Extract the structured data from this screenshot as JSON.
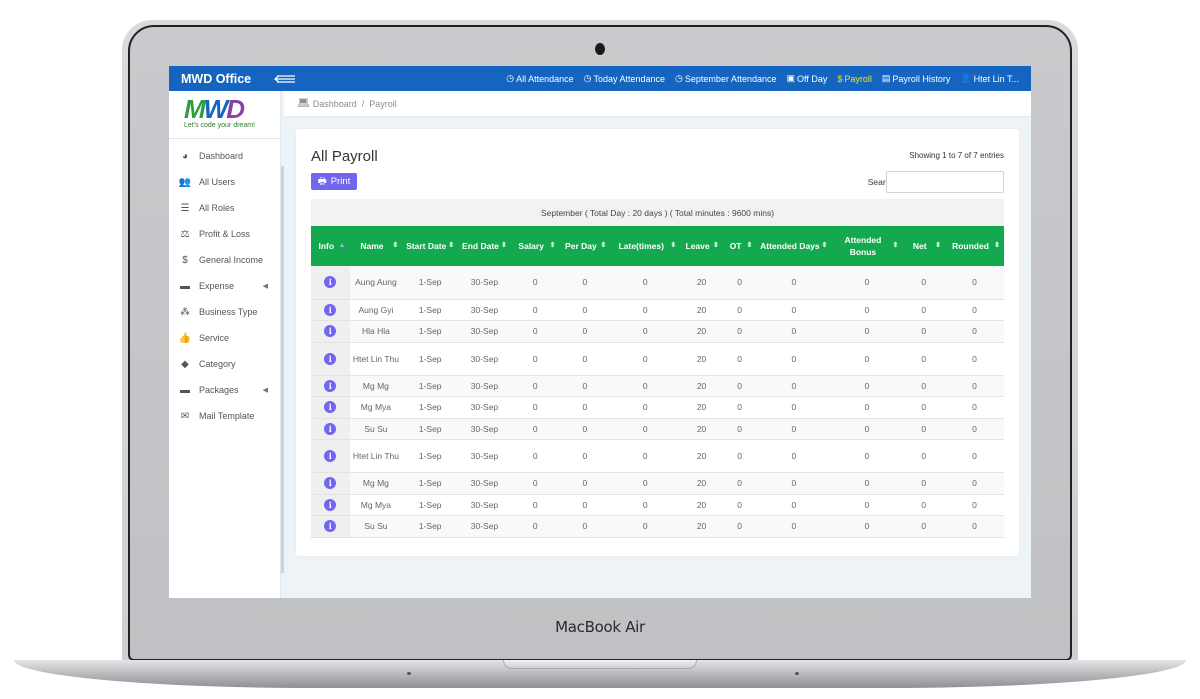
{
  "device": {
    "brand_label": "MacBook Air"
  },
  "topbar": {
    "app_title": "MWD Office",
    "nav": [
      {
        "label": "All Attendance",
        "icon": "clock-icon",
        "glyph": "◷",
        "active": false
      },
      {
        "label": "Today Attendance",
        "icon": "clock-icon",
        "glyph": "◷",
        "active": false
      },
      {
        "label": "September Attendance",
        "icon": "clock-icon",
        "glyph": "◷",
        "active": false
      },
      {
        "label": "Off Day",
        "icon": "calendar-icon",
        "glyph": "▣",
        "active": false
      },
      {
        "label": "Payroll",
        "icon": "dollar-icon",
        "glyph": "$",
        "active": true
      },
      {
        "label": "Payroll History",
        "icon": "document-icon",
        "glyph": "▤",
        "active": false
      },
      {
        "label": "Htet Lin T...",
        "icon": "user-icon",
        "glyph": "👤",
        "active": false
      }
    ],
    "active_color": "#f5e21c",
    "bar_color": "#1565c0"
  },
  "logo": {
    "text": "MWD",
    "tagline": "Let's code your dream!"
  },
  "sidebar": {
    "items": [
      {
        "label": "Dashboard",
        "icon": "dashboard-icon",
        "glyph": "◕",
        "has_submenu": false
      },
      {
        "label": "All Users",
        "icon": "users-icon",
        "glyph": "👥",
        "has_submenu": false
      },
      {
        "label": "All Roles",
        "icon": "list-icon",
        "glyph": "☰",
        "has_submenu": false
      },
      {
        "label": "Profit & Loss",
        "icon": "balance-scale-icon",
        "glyph": "⚖",
        "has_submenu": false
      },
      {
        "label": "General Income",
        "icon": "money-icon",
        "glyph": "$",
        "has_submenu": false
      },
      {
        "label": "Expense",
        "icon": "folder-icon",
        "glyph": "▬",
        "has_submenu": true
      },
      {
        "label": "Business Type",
        "icon": "cubes-icon",
        "glyph": "⁂",
        "has_submenu": false
      },
      {
        "label": "Service",
        "icon": "thumbs-up-icon",
        "glyph": "👍",
        "has_submenu": false
      },
      {
        "label": "Category",
        "icon": "tag-icon",
        "glyph": "◆",
        "has_submenu": false
      },
      {
        "label": "Packages",
        "icon": "folder-icon",
        "glyph": "▬",
        "has_submenu": true
      },
      {
        "label": "Mail Template",
        "icon": "envelope-icon",
        "glyph": "✉",
        "has_submenu": false
      }
    ]
  },
  "breadcrumb": {
    "items": [
      "Dashboard",
      "Payroll"
    ],
    "separator": "/"
  },
  "main": {
    "title": "All Payroll",
    "entries_info": "Showing 1 to 7 of 7 entries",
    "print_label": "Print",
    "search_label": "Search:",
    "search_value": "",
    "caption": "September ( Total Day : 20 days ) ( Total minutes : 9600 mins)",
    "accent_color": "#7266f0",
    "header_color": "#14a94f"
  },
  "table": {
    "columns": [
      "Info",
      "Name",
      "Start Date",
      "End Date",
      "Salary",
      "Per Day",
      "Late(times)",
      "Leave",
      "OT",
      "Attended Days",
      "Attended Bonus",
      "Net",
      "Rounded"
    ],
    "sort_column": "Info",
    "rows": [
      [
        "i",
        "Aung Aung",
        "1-Sep",
        "30-Sep",
        "0",
        "0",
        "0",
        "20",
        "0",
        "0",
        "0",
        "0",
        "0"
      ],
      [
        "i",
        "Aung Gyi",
        "1-Sep",
        "30-Sep",
        "0",
        "0",
        "0",
        "20",
        "0",
        "0",
        "0",
        "0",
        "0"
      ],
      [
        "i",
        "Hla Hla",
        "1-Sep",
        "30-Sep",
        "0",
        "0",
        "0",
        "20",
        "0",
        "0",
        "0",
        "0",
        "0"
      ],
      [
        "i",
        "Htet Lin Thu",
        "1-Sep",
        "30-Sep",
        "0",
        "0",
        "0",
        "20",
        "0",
        "0",
        "0",
        "0",
        "0"
      ],
      [
        "i",
        "Mg Mg",
        "1-Sep",
        "30-Sep",
        "0",
        "0",
        "0",
        "20",
        "0",
        "0",
        "0",
        "0",
        "0"
      ],
      [
        "i",
        "Mg Mya",
        "1-Sep",
        "30-Sep",
        "0",
        "0",
        "0",
        "20",
        "0",
        "0",
        "0",
        "0",
        "0"
      ],
      [
        "i",
        "Su Su",
        "1-Sep",
        "30-Sep",
        "0",
        "0",
        "0",
        "20",
        "0",
        "0",
        "0",
        "0",
        "0"
      ],
      [
        "i",
        "Htet Lin Thu",
        "1-Sep",
        "30-Sep",
        "0",
        "0",
        "0",
        "20",
        "0",
        "0",
        "0",
        "0",
        "0"
      ],
      [
        "i",
        "Mg Mg",
        "1-Sep",
        "30-Sep",
        "0",
        "0",
        "0",
        "20",
        "0",
        "0",
        "0",
        "0",
        "0"
      ],
      [
        "i",
        "Mg Mya",
        "1-Sep",
        "30-Sep",
        "0",
        "0",
        "0",
        "20",
        "0",
        "0",
        "0",
        "0",
        "0"
      ],
      [
        "i",
        "Su Su",
        "1-Sep",
        "30-Sep",
        "0",
        "0",
        "0",
        "20",
        "0",
        "0",
        "0",
        "0",
        "0"
      ]
    ]
  }
}
